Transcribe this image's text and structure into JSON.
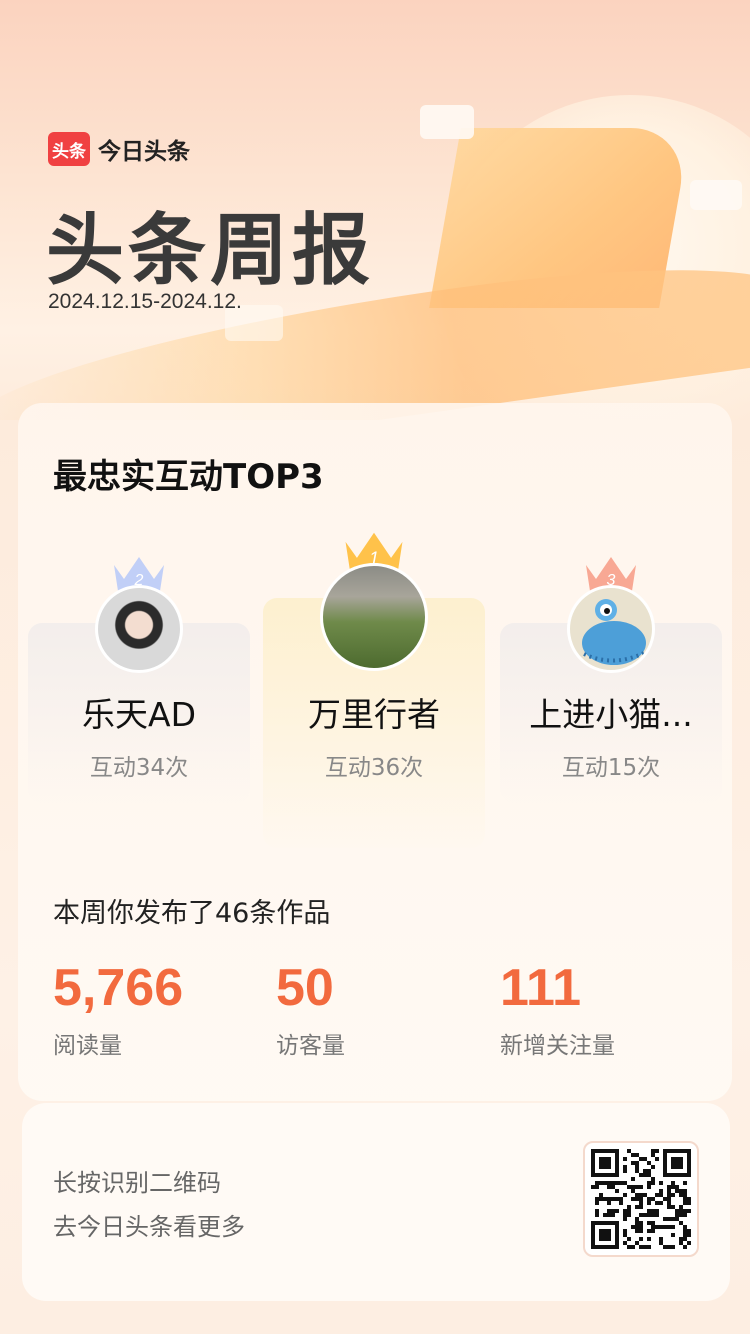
{
  "app": {
    "logo_text": "头条",
    "name": "今日头条"
  },
  "header": {
    "title": "头条周报",
    "date_range": "2024.12.15-2024.12."
  },
  "top3": {
    "title": "最忠实互动TOP3",
    "users": [
      {
        "rank": "2",
        "name": "乐天AD",
        "count": "互动34次"
      },
      {
        "rank": "1",
        "name": "万里行者",
        "count": "互动36次"
      },
      {
        "rank": "3",
        "name": "上进小猫...",
        "count": "互动15次"
      }
    ]
  },
  "summary": {
    "publish_text": "本周你发布了46条作品",
    "stats": [
      {
        "value": "5,766",
        "label": "阅读量"
      },
      {
        "value": "50",
        "label": "访客量"
      },
      {
        "value": "111",
        "label": "新增关注量"
      }
    ]
  },
  "footer": {
    "line1": "长按识别二维码",
    "line2": "去今日头条看更多"
  },
  "colors": {
    "accent": "#f26a3e",
    "brand_red": "#f04142",
    "crown_gold": "#ffc24a",
    "crown_silver": "#9fb7f5",
    "crown_bronze": "#f7a08a"
  },
  "icons": [
    "crown-icon",
    "qr-code-icon"
  ]
}
